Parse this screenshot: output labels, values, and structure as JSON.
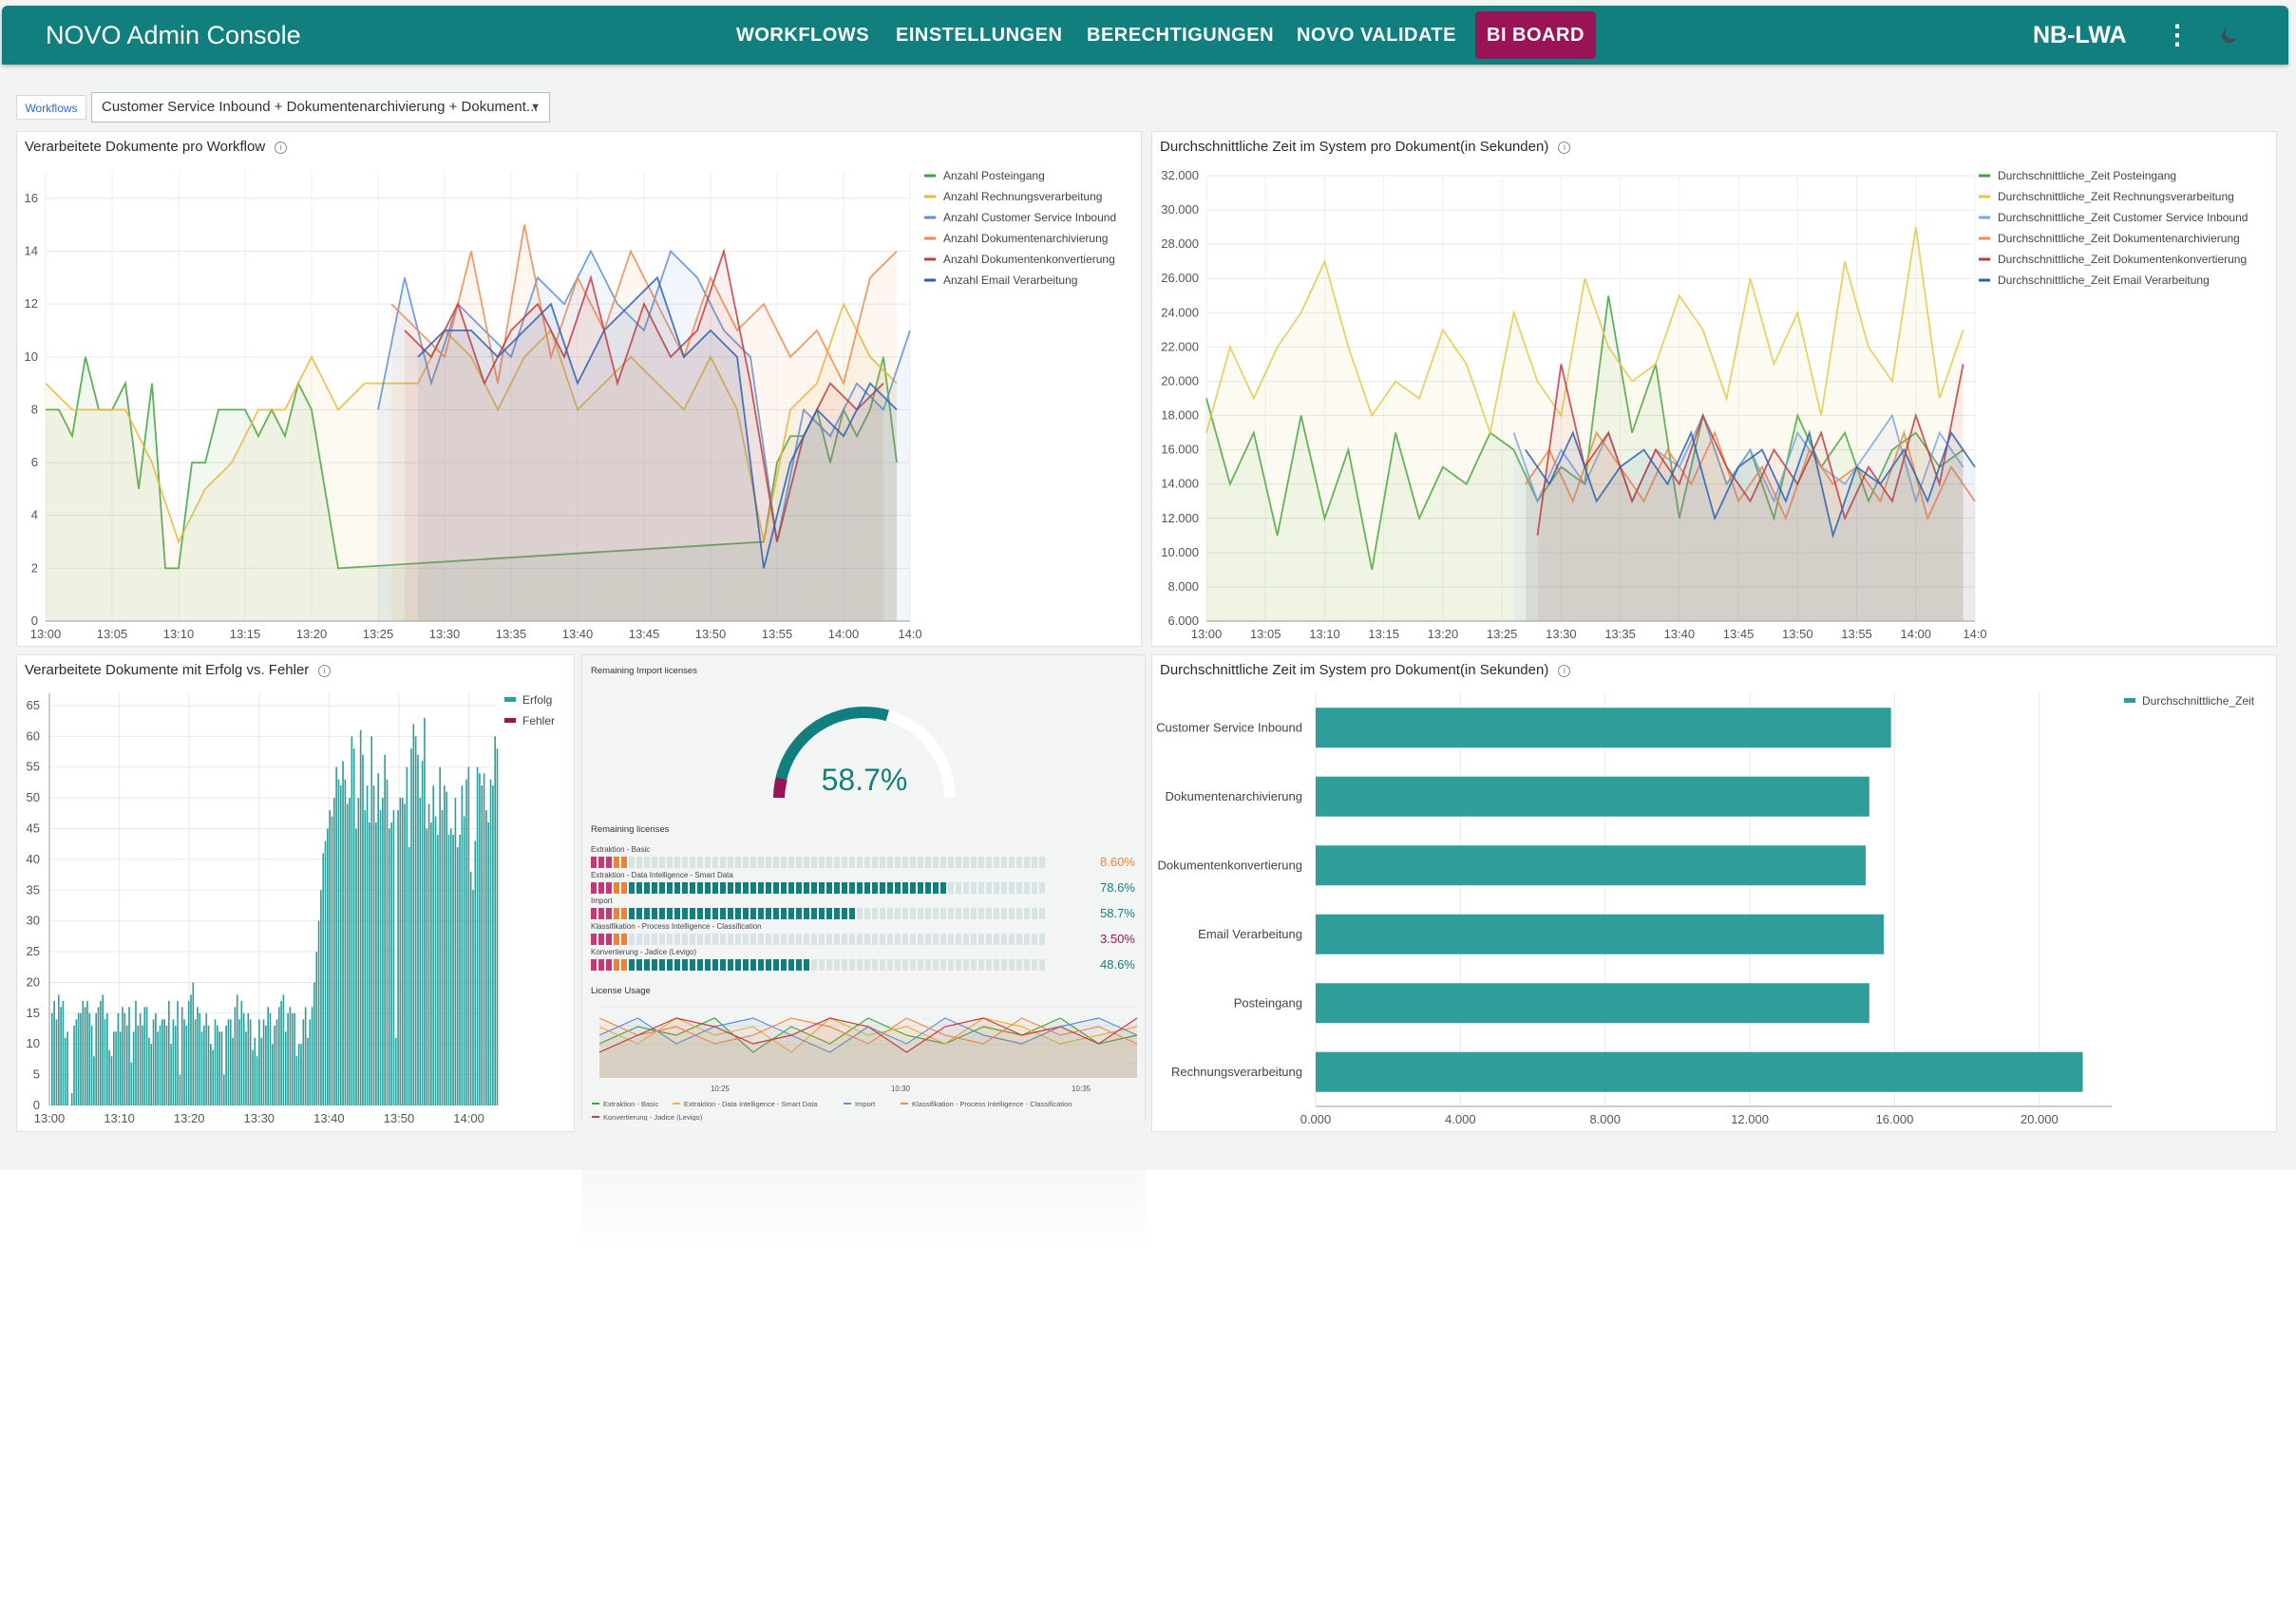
{
  "app": {
    "title": "NOVO Admin Console",
    "nav": [
      "WORKFLOWS",
      "EINSTELLUNGEN",
      "BERECHTIGUNGEN",
      "NOVO VALIDATE",
      "BI BOARD"
    ],
    "active_nav": "BI BOARD",
    "user": "NB-LWA",
    "menu_icon": "kebab-menu-icon",
    "theme_icon": "moon-icon",
    "brand_color": "#127f7f",
    "active_color": "#9b1357"
  },
  "filter": {
    "label": "Workflows",
    "value": "Customer Service Inbound + Dokumentenarchivierung + Dokument..."
  },
  "panels": {
    "p1": {
      "title": "Verarbeitete Dokumente pro Workflow"
    },
    "p2": {
      "title": "Durchschnittliche Zeit im System pro Dokument(in Sekunden)"
    },
    "p3": {
      "title": "Verarbeitete Dokumente mit Erfolg vs. Fehler"
    },
    "p4": {
      "title": "Remaining Import licenses",
      "gauge_value": "58.7%",
      "remaining_title": "Remaining licenses",
      "licenses": [
        {
          "name": "Extraktion - Basic",
          "pct": "8.60%",
          "color": "#e8843a",
          "fill": 0.086
        },
        {
          "name": "Extraktion - Data Intelligence - Smart Data",
          "pct": "78.6%",
          "color": "#127f7f",
          "fill": 0.786
        },
        {
          "name": "Import",
          "pct": "58.7%",
          "color": "#127f7f",
          "fill": 0.587
        },
        {
          "name": "Klassifikation - Process Intelligence - Classification",
          "pct": "3.50%",
          "color": "#9b1357",
          "fill": 0.035
        },
        {
          "name": "Konvertierung - Jadice (Levigo)",
          "pct": "48.6%",
          "color": "#127f7f",
          "fill": 0.486
        }
      ],
      "usage_title": "License Usage",
      "usage_x_ticks": [
        "10:25",
        "10:30",
        "10:35"
      ],
      "usage_legend": [
        "Extraktion - Basic",
        "Extraktion - Data Intelligence - Smart Data",
        "Import",
        "Klassifikation - Process Intelligence - Classification",
        "Konvertierung - Jadice (Levigo)"
      ]
    },
    "p5": {
      "title": "Durchschnittliche Zeit im System pro Dokument(in Sekunden)"
    }
  },
  "chart_data": [
    {
      "type": "line",
      "title": "Verarbeitete Dokumente pro Workflow",
      "ylim": [
        0,
        17
      ],
      "y_ticks": [
        "0",
        "2",
        "4",
        "6",
        "8",
        "10",
        "12",
        "14",
        "16"
      ],
      "x_ticks": [
        "13:00",
        "13:05",
        "13:10",
        "13:15",
        "13:20",
        "13:25",
        "13:30",
        "13:35",
        "13:40",
        "13:45",
        "13:50",
        "13:55",
        "14:00",
        "14:0"
      ],
      "series": [
        {
          "name": "Anzahl Posteingang",
          "color": "#3fa33f",
          "x": [
            0,
            1,
            2,
            3,
            4,
            5,
            6,
            7,
            8,
            9,
            10,
            11,
            12,
            13,
            14,
            15,
            16,
            17,
            18,
            19,
            20,
            21,
            22,
            54,
            55,
            56,
            57,
            58,
            59,
            60,
            61,
            62,
            63,
            64
          ],
          "values": [
            8,
            8,
            7,
            10,
            8,
            8,
            9,
            5,
            9,
            2,
            2,
            6,
            6,
            8,
            8,
            8,
            7,
            8,
            7,
            9,
            8,
            5,
            2,
            3,
            6,
            7,
            7,
            8,
            6,
            8,
            7,
            8,
            10,
            6
          ]
        },
        {
          "name": "Anzahl Rechnungsverarbeitung",
          "color": "#e8b83a",
          "x": [
            0,
            2,
            4,
            6,
            8,
            10,
            12,
            14,
            16,
            18,
            20,
            22,
            24,
            26,
            28,
            30,
            32,
            34,
            36,
            38,
            40,
            42,
            44,
            46,
            48,
            50,
            52,
            54,
            56,
            58,
            60,
            62,
            64
          ],
          "values": [
            9,
            8,
            8,
            8,
            6,
            3,
            5,
            6,
            8,
            8,
            10,
            8,
            9,
            9,
            9,
            11,
            10,
            8,
            10,
            11,
            8,
            9,
            10,
            9,
            8,
            10,
            8,
            3,
            8,
            9,
            12,
            10,
            9
          ]
        },
        {
          "name": "Anzahl Customer Service Inbound",
          "color": "#5b8fd6",
          "x": [
            25,
            27,
            29,
            31,
            33,
            35,
            37,
            39,
            41,
            43,
            45,
            47,
            49,
            51,
            53,
            55,
            57,
            59,
            61,
            63,
            65
          ],
          "values": [
            8,
            13,
            9,
            12,
            11,
            10,
            13,
            12,
            14,
            12,
            11,
            14,
            13,
            11,
            10,
            3,
            8,
            7,
            9,
            8,
            11
          ]
        },
        {
          "name": "Anzahl Dokumentenarchivierung",
          "color": "#f08a50",
          "x": [
            26,
            28,
            30,
            32,
            34,
            36,
            38,
            40,
            42,
            44,
            46,
            48,
            50,
            52,
            54,
            56,
            58,
            60,
            62,
            64
          ],
          "values": [
            12,
            11,
            10,
            14,
            9,
            15,
            10,
            13,
            11,
            14,
            12,
            10,
            13,
            11,
            12,
            10,
            11,
            9,
            13,
            14
          ]
        },
        {
          "name": "Anzahl Dokumentenkonvertierung",
          "color": "#c53b3b",
          "x": [
            27,
            29,
            31,
            33,
            35,
            37,
            39,
            41,
            43,
            45,
            47,
            49,
            51,
            53,
            55,
            57,
            59,
            61,
            63
          ],
          "values": [
            11,
            10,
            12,
            9,
            11,
            12,
            10,
            13,
            9,
            12,
            10,
            11,
            14,
            9,
            3,
            7,
            9,
            8,
            9
          ]
        },
        {
          "name": "Anzahl Email Verarbeitung",
          "color": "#2a62b5",
          "x": [
            28,
            30,
            32,
            34,
            36,
            38,
            40,
            42,
            44,
            46,
            48,
            50,
            52,
            54,
            56,
            58,
            60,
            62,
            64
          ],
          "values": [
            10,
            11,
            11,
            10,
            11,
            12,
            9,
            11,
            12,
            13,
            10,
            11,
            10,
            2,
            6,
            8,
            7,
            9,
            8
          ]
        }
      ]
    },
    {
      "type": "line",
      "title": "Durchschnittliche Zeit im System pro Dokument(in Sekunden)",
      "ylim": [
        6000,
        32000
      ],
      "y_ticks": [
        "6.000",
        "8.000",
        "10.000",
        "12.000",
        "14.000",
        "16.000",
        "18.000",
        "20.000",
        "22.000",
        "24.000",
        "26.000",
        "28.000",
        "30.000",
        "32.000"
      ],
      "x_ticks": [
        "13:00",
        "13:05",
        "13:10",
        "13:15",
        "13:20",
        "13:25",
        "13:30",
        "13:35",
        "13:40",
        "13:45",
        "13:50",
        "13:55",
        "14:00",
        "14:0"
      ],
      "series": [
        {
          "name": "Durchschnittliche_Zeit Posteingang",
          "color": "#3fa33f",
          "x": [
            0,
            2,
            4,
            6,
            8,
            10,
            12,
            14,
            16,
            18,
            20,
            22,
            24,
            26,
            28,
            30,
            32,
            34,
            36,
            38,
            40,
            42,
            44,
            46,
            48,
            50,
            52,
            54,
            56,
            58,
            60,
            62,
            64
          ],
          "values": [
            19000,
            14000,
            17000,
            11000,
            18000,
            12000,
            16000,
            9000,
            17000,
            12000,
            15000,
            14000,
            17000,
            16000,
            13000,
            15000,
            14000,
            25000,
            17000,
            21000,
            12000,
            18000,
            14000,
            16000,
            12000,
            18000,
            15000,
            17000,
            13000,
            16000,
            17000,
            15000,
            16000
          ]
        },
        {
          "name": "Durchschnittliche_Zeit Rechnungsverarbeitung",
          "color": "#e8c84a",
          "x": [
            0,
            2,
            4,
            6,
            8,
            10,
            12,
            14,
            16,
            18,
            20,
            22,
            24,
            26,
            28,
            30,
            32,
            34,
            36,
            38,
            40,
            42,
            44,
            46,
            48,
            50,
            52,
            54,
            56,
            58,
            60,
            62,
            64
          ],
          "values": [
            17000,
            22000,
            19000,
            22000,
            24000,
            27000,
            22000,
            18000,
            20000,
            19000,
            23000,
            21000,
            17000,
            24000,
            20000,
            18000,
            26000,
            22000,
            20000,
            21000,
            25000,
            23000,
            19000,
            26000,
            21000,
            24000,
            18000,
            27000,
            22000,
            20000,
            29000,
            19000,
            23000
          ]
        },
        {
          "name": "Durchschnittliche_Zeit Customer Service Inbound",
          "color": "#7aa7e0",
          "x": [
            26,
            28,
            30,
            32,
            34,
            36,
            38,
            40,
            42,
            44,
            46,
            48,
            50,
            52,
            54,
            56,
            58,
            60,
            62,
            64
          ],
          "values": [
            17000,
            13000,
            16000,
            14000,
            17000,
            13000,
            16000,
            15000,
            18000,
            14000,
            16000,
            13000,
            17000,
            15000,
            14000,
            16000,
            18000,
            13000,
            17000,
            15000
          ]
        },
        {
          "name": "Durchschnittliche_Zeit Dokumentenarchivierung",
          "color": "#f08a50",
          "x": [
            27,
            29,
            31,
            33,
            35,
            37,
            39,
            41,
            43,
            45,
            47,
            49,
            51,
            53,
            55,
            57,
            59,
            61,
            63,
            65
          ],
          "values": [
            14000,
            16000,
            13000,
            17000,
            15000,
            13000,
            16000,
            14000,
            17000,
            13000,
            15000,
            12000,
            16000,
            14000,
            15000,
            13000,
            17000,
            12000,
            15000,
            13000
          ]
        },
        {
          "name": "Durchschnittliche_Zeit Dokumentenkonvertierung",
          "color": "#c53b3b",
          "x": [
            28,
            30,
            32,
            34,
            36,
            38,
            40,
            42,
            44,
            46,
            48,
            50,
            52,
            54,
            56,
            58,
            60,
            62,
            64
          ],
          "values": [
            11000,
            21000,
            15000,
            17000,
            13000,
            16000,
            14000,
            18000,
            15000,
            13000,
            16000,
            14000,
            17000,
            12000,
            15000,
            13000,
            18000,
            14000,
            21000
          ]
        },
        {
          "name": "Durchschnittliche_Zeit Email Verarbeitung",
          "color": "#2a62b5",
          "x": [
            27,
            29,
            31,
            33,
            35,
            37,
            39,
            41,
            43,
            45,
            47,
            49,
            51,
            53,
            55,
            57,
            59,
            61,
            63,
            65
          ],
          "values": [
            16000,
            14000,
            17000,
            13000,
            15000,
            16000,
            14000,
            17000,
            12000,
            15000,
            16000,
            13000,
            17000,
            11000,
            15000,
            14000,
            16000,
            13000,
            17000,
            15000
          ]
        }
      ]
    },
    {
      "type": "bar",
      "title": "Verarbeitete Dokumente mit Erfolg vs. Fehler",
      "ylim": [
        0,
        67
      ],
      "y_ticks": [
        "0",
        "5",
        "10",
        "15",
        "20",
        "25",
        "30",
        "35",
        "40",
        "45",
        "50",
        "55",
        "60",
        "65"
      ],
      "x_ticks": [
        "13:00",
        "13:10",
        "13:20",
        "13:30",
        "13:40",
        "13:50",
        "14:00"
      ],
      "series": [
        {
          "name": "Erfolg",
          "color": "#2f9e9a",
          "values": [
            15,
            17,
            14,
            18,
            16,
            17,
            11,
            12,
            0,
            2,
            13,
            14,
            15,
            15,
            17,
            16,
            17,
            15,
            13,
            8,
            15,
            16,
            17,
            18,
            14,
            15,
            9,
            8,
            12,
            12,
            15,
            12,
            16,
            15,
            13,
            16,
            7,
            12,
            17,
            13,
            15,
            13,
            16,
            16,
            11,
            10,
            14,
            15,
            12,
            13,
            14,
            14,
            13,
            17,
            10,
            14,
            13,
            17,
            5,
            16,
            14,
            13,
            17,
            18,
            20,
            14,
            16,
            15,
            12,
            13,
            15,
            13,
            10,
            9,
            14,
            13,
            12,
            12,
            5,
            13,
            14,
            14,
            11,
            16,
            18,
            14,
            17,
            15,
            12,
            15,
            14,
            9,
            11,
            8,
            14,
            11,
            14,
            13,
            16,
            15,
            10,
            13,
            14,
            16,
            17,
            18,
            12,
            15,
            16,
            15,
            15,
            8,
            10,
            10,
            14,
            16,
            11,
            14,
            16,
            20,
            25,
            30,
            35,
            41,
            43,
            45,
            48,
            47,
            50,
            55,
            53,
            52,
            56,
            53,
            49,
            50,
            60,
            58,
            45,
            50,
            61,
            57,
            48,
            52,
            46,
            60,
            52,
            46,
            54,
            48,
            50,
            57,
            53,
            45,
            46,
            48,
            11,
            48,
            50,
            50,
            49,
            55,
            42,
            58,
            62,
            60,
            57,
            50,
            56,
            63,
            45,
            49,
            46,
            52,
            47,
            44,
            55,
            48,
            52,
            51,
            44,
            45,
            44,
            50,
            42,
            44,
            52,
            47,
            53,
            55,
            38,
            35,
            43,
            55,
            54,
            52,
            54,
            48,
            46,
            53,
            52,
            60,
            58
          ]
        },
        {
          "name": "Fehler",
          "color": "#9b1357",
          "values": []
        }
      ]
    },
    {
      "type": "bar",
      "title": "Durchschnittliche Zeit im System pro Dokument(in Sekunden)",
      "orientation": "horizontal",
      "categories": [
        "Customer Service Inbound",
        "Dokumentenarchivierung",
        "Dokumentenkonvertierung",
        "Email Verarbeitung",
        "Posteingang",
        "Rechnungsverarbeitung"
      ],
      "values": [
        15900,
        15300,
        15200,
        15700,
        15300,
        21200
      ],
      "xlim": [
        0,
        22000
      ],
      "x_ticks": [
        "0.000",
        "4.000",
        "8.000",
        "12.000",
        "16.000",
        "20.000"
      ],
      "series": [
        {
          "name": "Durchschnittliche_Zeit",
          "color": "#2f9e9a"
        }
      ]
    }
  ]
}
